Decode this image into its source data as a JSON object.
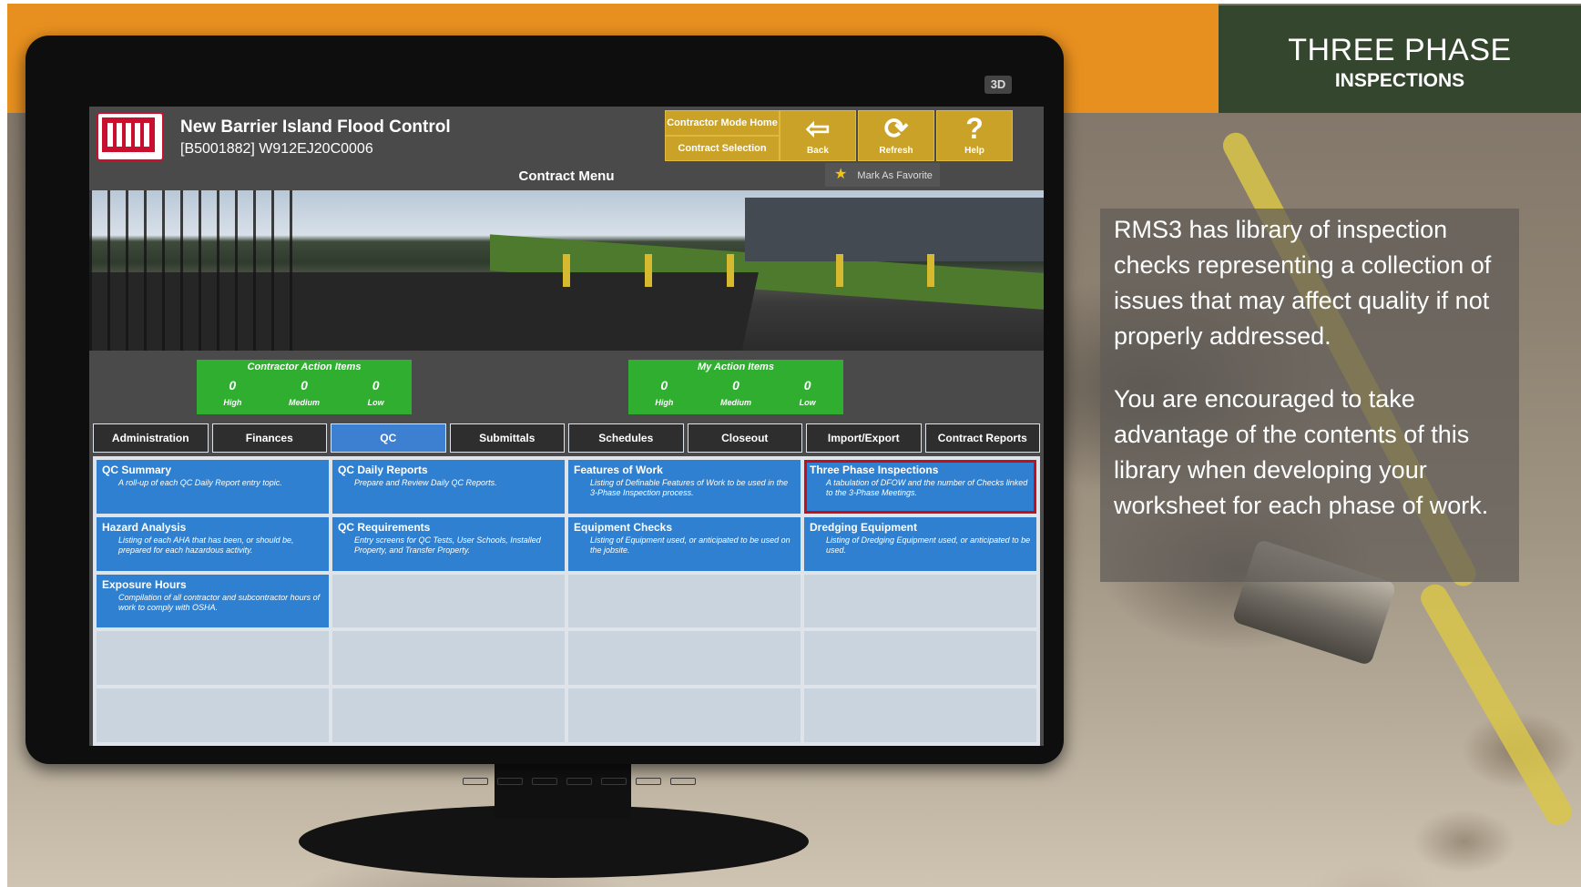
{
  "slide": {
    "title_line1": "THREE PHASE",
    "title_line2": "INSPECTIONS",
    "info_paragraphs": [
      "RMS3 has library of inspection checks representing a collection of issues that may affect quality if not properly addressed.",
      "You are encouraged to take advantage of the contents of this library when developing your worksheet for each phase of work."
    ]
  },
  "monitor": {
    "badge": "3D"
  },
  "app": {
    "project_title": "New Barrier Island Flood Control",
    "project_id": "[B5001882] W912EJ20C0006",
    "contractor_mode_home": "Contractor Mode Home",
    "contract_selection": "Contract Selection",
    "back_label": "Back",
    "refresh_label": "Refresh",
    "help_label": "Help",
    "menu_title": "Contract Menu",
    "favorite_label": "Mark As Favorite",
    "contractor_action_items": {
      "title": "Contractor Action Items",
      "values": [
        "0",
        "0",
        "0"
      ],
      "labels": [
        "High",
        "Medium",
        "Low"
      ]
    },
    "my_action_items": {
      "title": "My Action Items",
      "values": [
        "0",
        "0",
        "0"
      ],
      "labels": [
        "High",
        "Medium",
        "Low"
      ]
    },
    "tabs": [
      "Administration",
      "Finances",
      "QC",
      "Submittals",
      "Schedules",
      "Closeout",
      "Import/Export",
      "Contract Reports"
    ],
    "active_tab": "QC",
    "tiles": [
      {
        "title": "QC Summary",
        "desc": "A roll-up of each QC Daily Report entry topic."
      },
      {
        "title": "QC Daily Reports",
        "desc": "Prepare and Review Daily QC Reports."
      },
      {
        "title": "Features of Work",
        "desc": "Listing of Definable Features of Work to be used in the 3-Phase Inspection process."
      },
      {
        "title": "Three Phase Inspections",
        "desc": "A tabulation of DFOW and the number of Checks linked to the 3-Phase Meetings."
      },
      {
        "title": "Hazard Analysis",
        "desc": "Listing of each AHA that has been, or should be, prepared for each hazardous activity."
      },
      {
        "title": "QC Requirements",
        "desc": "Entry screens for QC Tests, User Schools, Installed Property, and Transfer Property."
      },
      {
        "title": "Equipment Checks",
        "desc": "Listing of Equipment used, or anticipated to be used on the jobsite."
      },
      {
        "title": "Dredging Equipment",
        "desc": "Listing of Dredging Equipment used, or anticipated to be used."
      },
      {
        "title": "Exposure Hours",
        "desc": "Compilation of all contractor and subcontractor hours of work to comply with OSHA."
      }
    ],
    "selected_tile": "Three Phase Inspections"
  }
}
